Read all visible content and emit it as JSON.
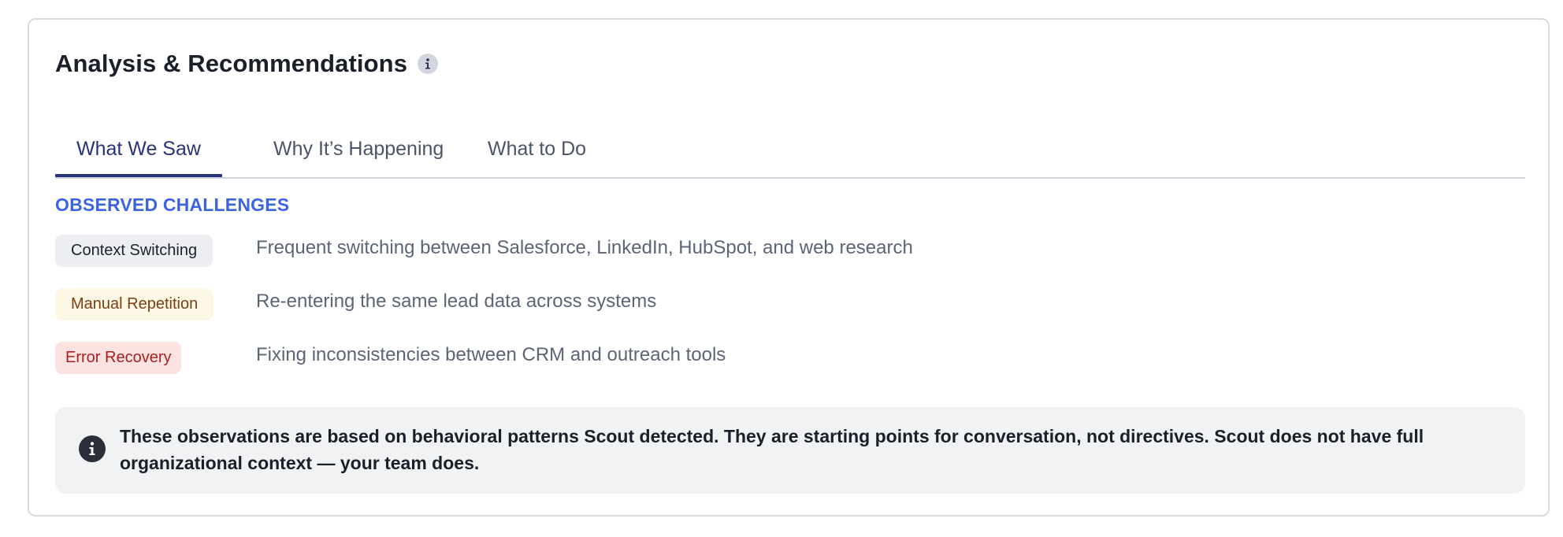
{
  "panel": {
    "title": "Analysis & Recommendations",
    "info_icon": "info-icon"
  },
  "tabs": [
    {
      "label": "What We Saw",
      "active": true
    },
    {
      "label": "Why It’s Happening",
      "active": false
    },
    {
      "label": "What to Do",
      "active": false
    }
  ],
  "observed": {
    "heading": "OBSERVED CHALLENGES",
    "items": [
      {
        "badge": "Context Switching",
        "badge_color": "#eceef2",
        "description": "Frequent switching between Salesforce, LinkedIn, HubSpot, and web research"
      },
      {
        "badge": "Manual Repetition",
        "badge_color": "#fdf8e6",
        "description": "Re-entering the same lead data across systems"
      },
      {
        "badge": "Error Recovery",
        "badge_color": "#fde2e2",
        "description": "Fixing inconsistencies between CRM and outreach tools"
      }
    ]
  },
  "note": {
    "icon": "info-icon",
    "text": "These observations are based on behavioral patterns Scout detected. They are starting points for conversation, not directives. Scout does not have full organizational context — your team does."
  },
  "colors": {
    "accent": "#283378",
    "section_heading": "#3d64e0"
  }
}
